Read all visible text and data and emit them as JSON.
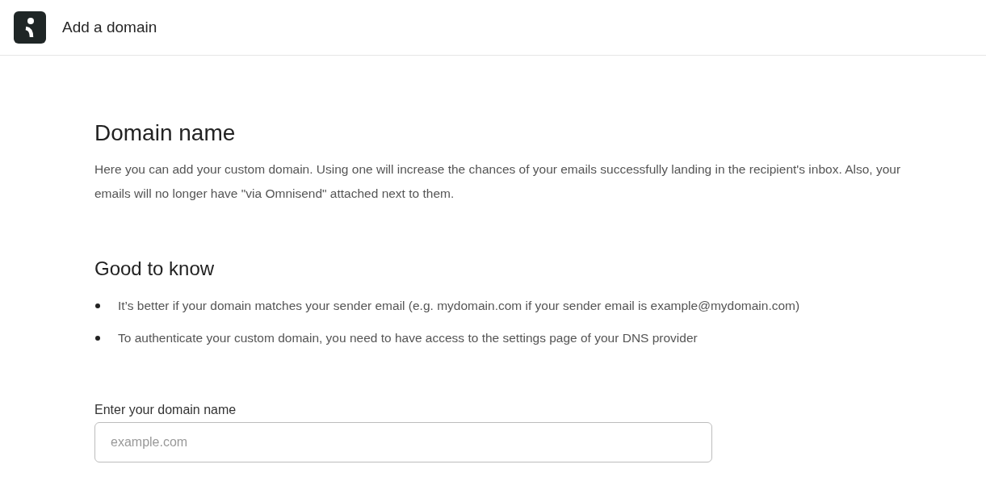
{
  "header": {
    "title": "Add a domain"
  },
  "sections": [
    {
      "heading": "Domain name",
      "text": "Here you can add your custom domain. Using one will increase the chances of your emails successfully landing in the recipient's inbox. Also, your emails will no longer have \"via Omnisend\" attached next to them."
    },
    {
      "heading": "Good to know",
      "bullets": [
        "It’s better if your domain matches your sender email (e.g. mydomain.com if your sender email is example@mydomain.com)",
        "To authenticate your custom domain, you need to have access to the settings page of your DNS provider"
      ]
    }
  ],
  "field": {
    "label": "Enter your domain name",
    "placeholder": "example.com"
  }
}
